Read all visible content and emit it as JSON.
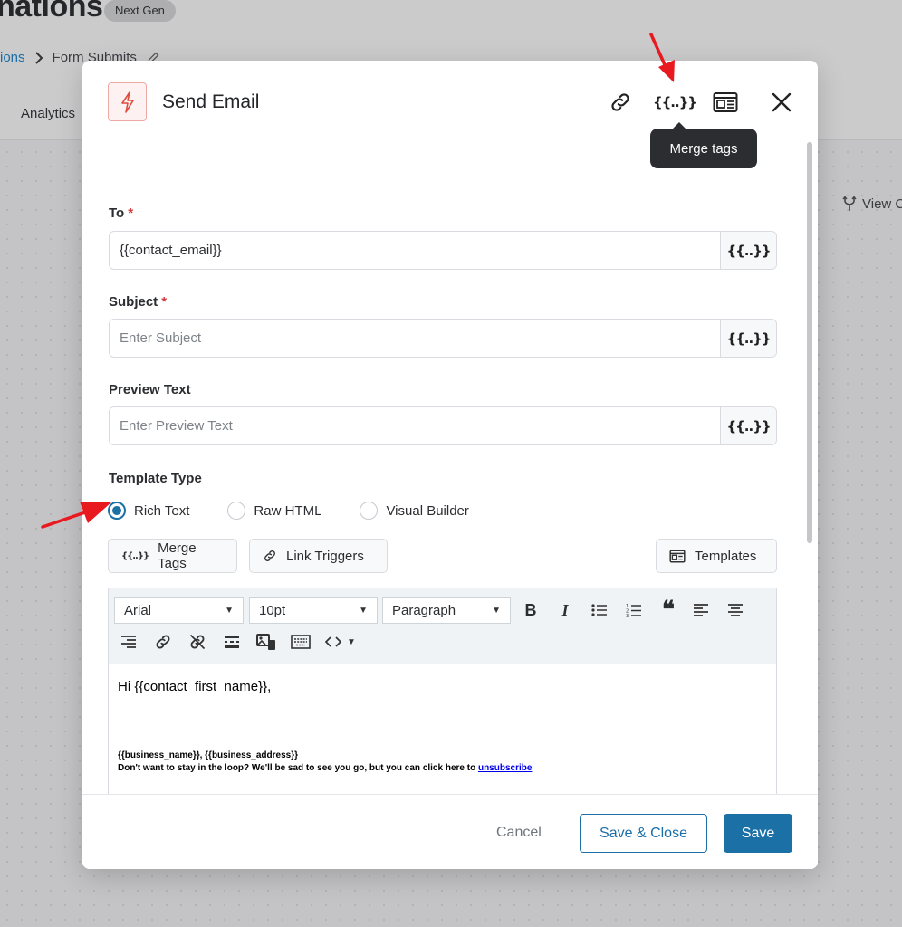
{
  "background": {
    "title": "nations",
    "badge": "Next Gen",
    "breadcrumb": {
      "parent": "ions",
      "current": "Form Submits"
    },
    "tab": "Analytics",
    "view_link": "View C"
  },
  "modal": {
    "title": "Send Email",
    "header_icons": [
      "link-icon",
      "merge-tags-icon",
      "template-icon",
      "close-icon"
    ],
    "merge_glyph": "{{..}}",
    "tooltip": "Merge tags",
    "to": {
      "label": "To",
      "required_mark": "*",
      "value": "{{contact_email}}"
    },
    "subject": {
      "label": "Subject",
      "required_mark": "*",
      "placeholder": "Enter Subject"
    },
    "preview": {
      "label": "Preview Text",
      "placeholder": "Enter Preview Text"
    },
    "template_type": {
      "label": "Template Type",
      "options": [
        "Rich Text",
        "Raw HTML",
        "Visual Builder"
      ],
      "selected": "Rich Text"
    },
    "tools": {
      "merge_tags": "Merge Tags",
      "link_triggers": "Link Triggers",
      "templates": "Templates"
    },
    "editor": {
      "font": "Arial",
      "size": "10pt",
      "block": "Paragraph",
      "greeting": "Hi {{contact_first_name}},",
      "footer_line1": "{{business_name}}, {{business_address}}",
      "footer_line2": "Don't want to stay in the loop? We'll be sad to see you go, but you can click here to",
      "unsubscribe": "unsubscribe"
    },
    "footer": {
      "cancel": "Cancel",
      "save_close": "Save & Close",
      "save": "Save"
    }
  },
  "colors": {
    "primary": "#1b70a6",
    "required": "#d63638",
    "arrow": "#e8191f"
  }
}
